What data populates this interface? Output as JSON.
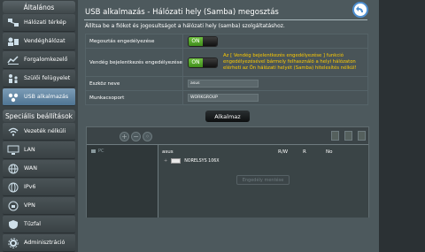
{
  "sidebar": {
    "section1": "Általános",
    "items1": [
      {
        "label": "Hálózati térkép",
        "icon": "network-map-icon"
      },
      {
        "label": "Vendéghálózat",
        "icon": "guest-network-icon"
      },
      {
        "label": "Forgalomkezelő",
        "icon": "traffic-manager-icon"
      },
      {
        "label": "Szülői felügyelet",
        "icon": "parental-control-icon"
      },
      {
        "label": "USB alkalmazás",
        "icon": "usb-app-icon",
        "active": true
      }
    ],
    "section2": "Speciális beállítások",
    "items2": [
      {
        "label": "Vezeték nélküli",
        "icon": "wireless-icon"
      },
      {
        "label": "LAN",
        "icon": "lan-icon"
      },
      {
        "label": "WAN",
        "icon": "wan-icon"
      },
      {
        "label": "IPv6",
        "icon": "ipv6-icon"
      },
      {
        "label": "VPN",
        "icon": "vpn-icon"
      },
      {
        "label": "Tűzfal",
        "icon": "firewall-icon"
      },
      {
        "label": "Adminisztráció",
        "icon": "administration-icon"
      }
    ]
  },
  "main": {
    "title": "USB alkalmazás - Hálózati hely (Samba) megosztás",
    "description": "Állítsa be a fiókot és jogosultságot a hálózati hely (samba) szolgáltatáshoz.",
    "form": {
      "share_label": "Megosztás engedélyezése",
      "share_state": "ON",
      "guest_label": "Vendég bejelentkezés engedélyezése",
      "guest_state": "ON",
      "guest_warning": "Az [ Vendég bejelentkezés engedélyezése ] funkció engedélyezésével bármely felhasználó a helyi hálózaton elérheti az Ön hálózati helyét (Samba) hitelesítés nélkül!",
      "device_label": "Eszköz neve",
      "device_value": "asus",
      "workgroup_label": "Munkacsoport",
      "workgroup_value": "WORKGROUP"
    },
    "apply_label": "Alkalmaz",
    "tree": {
      "pc_label": "PC",
      "columns": {
        "name": "asus",
        "rw": "R/W",
        "r": "R",
        "no": "No"
      },
      "disk_label": "NORELSYS 106X",
      "permission_button": "Engedély mentése"
    }
  },
  "colors": {
    "accent": "#4f7593",
    "toggle_on": "#57a72c",
    "warning": "#ffcc00"
  }
}
